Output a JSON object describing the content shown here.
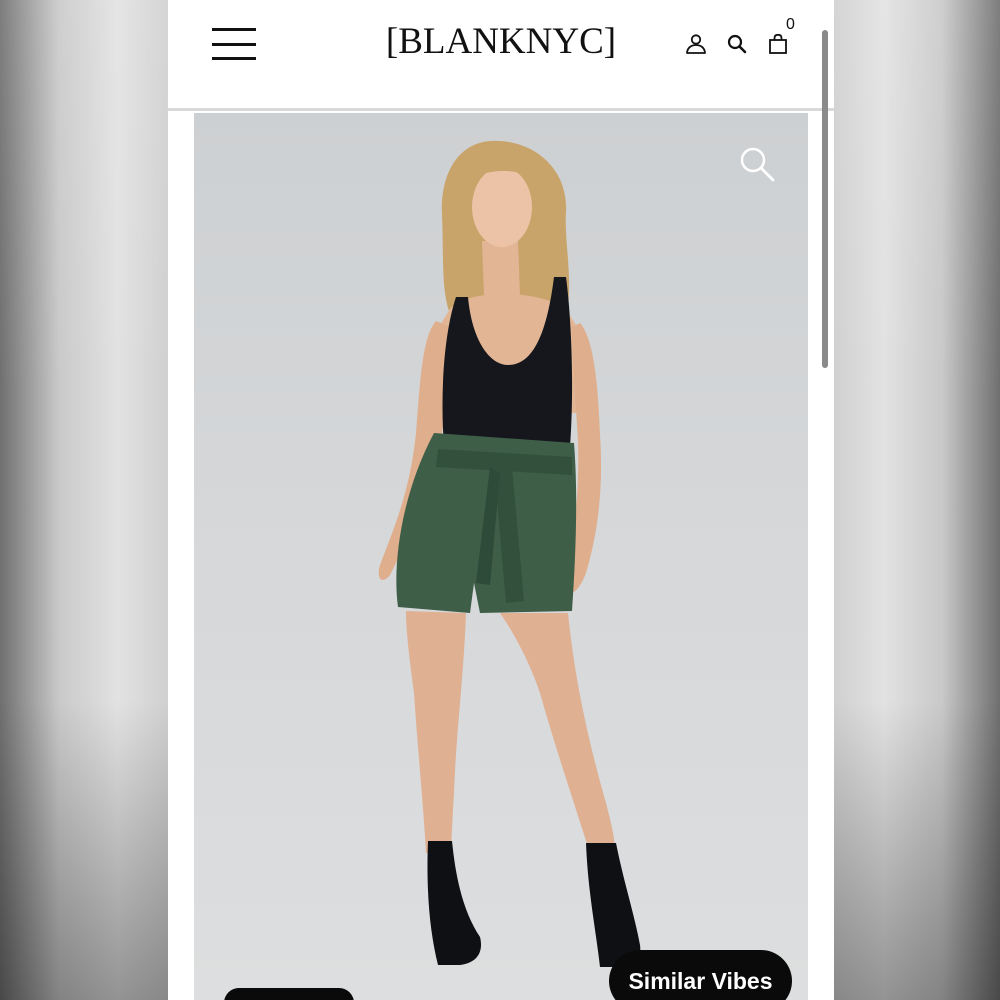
{
  "header": {
    "logo": "[BLANKNYC]",
    "cart_count": "0",
    "icons": [
      "menu-icon",
      "user-icon",
      "search-icon",
      "bag-icon"
    ]
  },
  "product": {
    "image_icon": "zoom-icon"
  },
  "actions": {
    "similar_label": "Similar Vibes"
  },
  "colors": {
    "brand_text": "#111111",
    "button_bg": "#0a0a0a",
    "image_bg": "#d3d6d8"
  }
}
